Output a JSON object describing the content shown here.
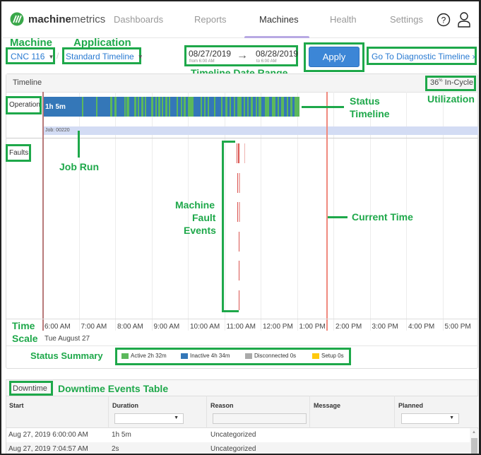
{
  "app": {
    "brand_bold": "machine",
    "brand_light": "metrics"
  },
  "nav": {
    "items": [
      {
        "label": "Dashboards",
        "active": false
      },
      {
        "label": "Reports",
        "active": false
      },
      {
        "label": "Machines",
        "active": true
      },
      {
        "label": "Health",
        "active": false
      },
      {
        "label": "Settings",
        "active": false
      }
    ],
    "icons": [
      "help-icon",
      "user-icon"
    ]
  },
  "controls": {
    "machine": "CNC 116",
    "application": "Standard Timeline",
    "separator": "/",
    "date_from": "08/27/2019",
    "date_from_sub": "from 6:00 AM",
    "date_to": "08/28/2019",
    "date_to_sub": "to 6:00 AM",
    "arrow": "→",
    "apply_label": "Apply",
    "diagnostic_link": "Go To Diagnostic Timeline ›"
  },
  "annotations": {
    "machine": "Machine",
    "application": "Application",
    "date_range": "Timeline Date Range",
    "status_timeline_1": "Status",
    "status_timeline_2": "Timeline",
    "utilization": "Utilization",
    "job_run": "Job Run",
    "fault_1": "Machine",
    "fault_2": "Fault",
    "fault_3": "Events",
    "current_time": "Current Time",
    "time_1": "Time",
    "time_2": "Scale",
    "status_summary": "Status Summary",
    "downtime_table": "Downtime Events Table"
  },
  "timeline": {
    "title": "Timeline",
    "in_cycle_value": "36",
    "in_cycle_unit": "%",
    "in_cycle_label": " In-Cycle",
    "rows": {
      "operation": "Operation",
      "faults": "Faults"
    },
    "status_label": "1h 5m",
    "job_label": "Job: 00220",
    "time_ticks": [
      "6:00 AM",
      "7:00 AM",
      "8:00 AM",
      "9:00 AM",
      "10:00 AM",
      "11:00 AM",
      "12:00 PM",
      "1:00 PM",
      "2:00 PM",
      "3:00 PM",
      "4:00 PM",
      "5:00 PM"
    ],
    "date_label": "Tue August 27",
    "range_start_hour": 6,
    "range_end_hour": 18,
    "status_end_hour": 13.05,
    "current_time_hour": 13.8,
    "active_segments_hours": [
      [
        7.07,
        7.1
      ],
      [
        7.45,
        7.49
      ],
      [
        7.84,
        7.9
      ],
      [
        7.96,
        8.02
      ],
      [
        8.23,
        8.27
      ],
      [
        8.3,
        8.36
      ],
      [
        8.51,
        8.56
      ],
      [
        8.6,
        8.63
      ],
      [
        8.7,
        8.76
      ],
      [
        8.8,
        8.83
      ],
      [
        8.97,
        9.02
      ],
      [
        9.08,
        9.12
      ],
      [
        9.17,
        9.22
      ],
      [
        9.27,
        9.3
      ],
      [
        9.36,
        9.42
      ],
      [
        9.46,
        9.5
      ],
      [
        9.67,
        9.7
      ],
      [
        9.78,
        9.82
      ],
      [
        9.87,
        9.92
      ],
      [
        9.98,
        10.13
      ],
      [
        10.33,
        10.36
      ],
      [
        10.43,
        10.47
      ],
      [
        10.53,
        10.56
      ],
      [
        10.7,
        10.74
      ],
      [
        10.9,
        10.94
      ],
      [
        11.0,
        11.06
      ],
      [
        11.12,
        11.15
      ],
      [
        11.25,
        11.28
      ],
      [
        11.34,
        11.45
      ],
      [
        11.52,
        11.56
      ],
      [
        11.62,
        11.65
      ],
      [
        11.7,
        11.77
      ],
      [
        11.84,
        11.88
      ],
      [
        11.93,
        12.0
      ],
      [
        12.1,
        12.22
      ],
      [
        12.3,
        12.38
      ],
      [
        12.45,
        12.48
      ],
      [
        12.55,
        12.62
      ],
      [
        12.7,
        12.74
      ],
      [
        12.8,
        12.86
      ],
      [
        12.92,
        13.05
      ]
    ],
    "fault_events": [
      {
        "hour": 11.34,
        "rows": [
          0
        ],
        "shade": "dark"
      },
      {
        "hour": 11.37,
        "rows": [
          0
        ],
        "shade": "dark"
      },
      {
        "hour": 11.4,
        "rows": [
          0
        ],
        "shade": "dark"
      },
      {
        "hour": 11.56,
        "rows": [
          0
        ],
        "shade": "light"
      },
      {
        "hour": 11.35,
        "rows": [
          1,
          2
        ],
        "shade": "dark"
      },
      {
        "hour": 11.39,
        "rows": [
          1,
          2
        ],
        "shade": "light"
      },
      {
        "hour": 11.41,
        "rows": [
          1,
          2
        ],
        "shade": "light"
      },
      {
        "hour": 11.39,
        "rows": [
          3,
          4,
          5
        ],
        "shade": "dark"
      }
    ]
  },
  "status_summary": [
    {
      "label": "Active 2h 32m",
      "color": "#5cb85c"
    },
    {
      "label": "Inactive 4h 34m",
      "color": "#3477b8"
    },
    {
      "label": "Disconnected 0s",
      "color": "#aaaaaa"
    },
    {
      "label": "Setup 0s",
      "color": "#ffc90e"
    }
  ],
  "downtime": {
    "title": "Downtime",
    "columns": [
      "Start",
      "Duration",
      "Reason",
      "Message",
      "Planned"
    ],
    "filters": {
      "duration": "",
      "reason": "",
      "planned": ""
    },
    "rows": [
      {
        "start": "Aug 27, 2019 6:00:00 AM",
        "duration": "1h 5m",
        "reason": "Uncategorized",
        "message": "",
        "planned": ""
      },
      {
        "start": "Aug 27, 2019 7:04:57 AM",
        "duration": "2s",
        "reason": "Uncategorized",
        "message": "",
        "planned": ""
      }
    ]
  },
  "colors": {
    "accent": "#3c86d6",
    "link": "#2a7bd2",
    "active": "#5cb85c",
    "inactive": "#3477b8",
    "fault": "#d9534f",
    "current_time": "#f08a7e",
    "annotation": "#1ea84a"
  }
}
